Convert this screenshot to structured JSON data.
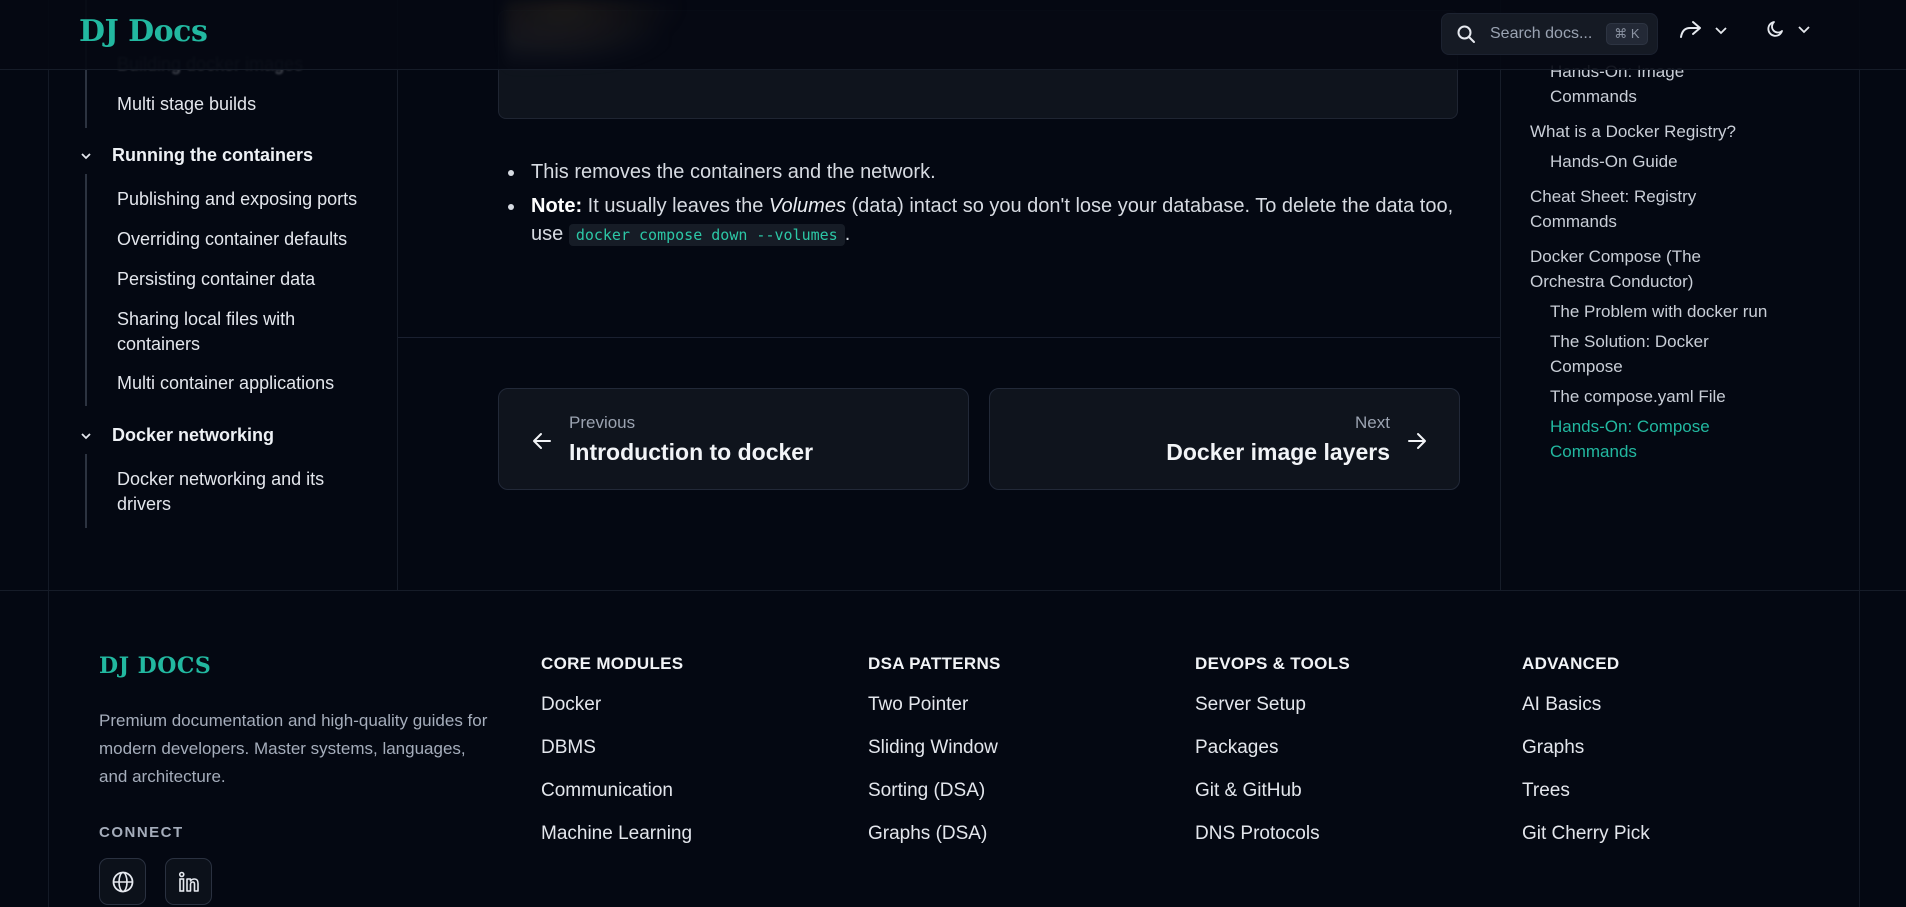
{
  "header": {
    "logo": "DJ Docs",
    "search_placeholder": "Search docs...",
    "search_shortcut": "⌘ K",
    "share_icon": "share-icon",
    "theme_icon": "moon-icon"
  },
  "sidebar": {
    "partial_top": "Building docker images",
    "item_multistage": "Multi stage builds",
    "group_running": "Running the containers",
    "running_items": [
      "Publishing and exposing ports",
      "Overriding container defaults",
      "Persisting container data",
      "Sharing local files with containers",
      "Multi container applications"
    ],
    "group_networking": "Docker networking",
    "networking_items": [
      "Docker networking and its drivers"
    ]
  },
  "content": {
    "bullet1": "This removes the containers and the network.",
    "bullet2_strong": "Note:",
    "bullet2_a": " It usually leaves the ",
    "bullet2_em": "Volumes",
    "bullet2_b": " (data) intact so you don't lose your database. To delete the data too, use ",
    "bullet2_code": "docker compose down --volumes",
    "bullet2_end": "."
  },
  "pager": {
    "prev_kicker": "Previous",
    "prev_title": "Introduction to docker",
    "next_kicker": "Next",
    "next_title": "Docker image layers"
  },
  "toc": {
    "items": [
      "Hands-On: Image Commands",
      "What is a Docker Registry?",
      "Hands-On Guide",
      "Cheat Sheet: Registry Commands",
      "Docker Compose (The Orchestra Conductor)",
      "The Problem with docker run",
      "The Solution: Docker Compose",
      "The compose.yaml File",
      "Hands-On: Compose Commands"
    ],
    "active_color": "#22b8a0"
  },
  "footer": {
    "logo": "DJ DOCS",
    "description": "Premium documentation and high-quality guides for modern developers. Master systems, languages, and architecture.",
    "connect": "CONNECT",
    "columns": [
      {
        "heading": "CORE MODULES",
        "links": [
          "Docker",
          "DBMS",
          "Communication",
          "Machine Learning"
        ]
      },
      {
        "heading": "DSA PATTERNS",
        "links": [
          "Two Pointer",
          "Sliding Window",
          "Sorting (DSA)",
          "Graphs (DSA)"
        ]
      },
      {
        "heading": "DEVOPS & TOOLS",
        "links": [
          "Server Setup",
          "Packages",
          "Git & GitHub",
          "DNS Protocols"
        ]
      },
      {
        "heading": "ADVANCED",
        "links": [
          "AI Basics",
          "Graphs",
          "Trees",
          "Git Cherry Pick"
        ]
      }
    ]
  }
}
